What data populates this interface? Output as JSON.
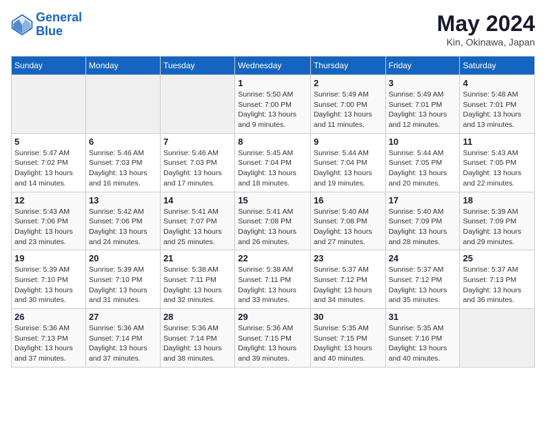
{
  "header": {
    "logo_line1": "General",
    "logo_line2": "Blue",
    "main_title": "May 2024",
    "subtitle": "Kin, Okinawa, Japan"
  },
  "weekdays": [
    "Sunday",
    "Monday",
    "Tuesday",
    "Wednesday",
    "Thursday",
    "Friday",
    "Saturday"
  ],
  "weeks": [
    [
      {
        "day": "",
        "info": ""
      },
      {
        "day": "",
        "info": ""
      },
      {
        "day": "",
        "info": ""
      },
      {
        "day": "1",
        "info": "Sunrise: 5:50 AM\nSunset: 7:00 PM\nDaylight: 13 hours and 9 minutes."
      },
      {
        "day": "2",
        "info": "Sunrise: 5:49 AM\nSunset: 7:00 PM\nDaylight: 13 hours and 11 minutes."
      },
      {
        "day": "3",
        "info": "Sunrise: 5:49 AM\nSunset: 7:01 PM\nDaylight: 13 hours and 12 minutes."
      },
      {
        "day": "4",
        "info": "Sunrise: 5:48 AM\nSunset: 7:01 PM\nDaylight: 13 hours and 13 minutes."
      }
    ],
    [
      {
        "day": "5",
        "info": "Sunrise: 5:47 AM\nSunset: 7:02 PM\nDaylight: 13 hours and 14 minutes."
      },
      {
        "day": "6",
        "info": "Sunrise: 5:46 AM\nSunset: 7:03 PM\nDaylight: 13 hours and 16 minutes."
      },
      {
        "day": "7",
        "info": "Sunrise: 5:46 AM\nSunset: 7:03 PM\nDaylight: 13 hours and 17 minutes."
      },
      {
        "day": "8",
        "info": "Sunrise: 5:45 AM\nSunset: 7:04 PM\nDaylight: 13 hours and 18 minutes."
      },
      {
        "day": "9",
        "info": "Sunrise: 5:44 AM\nSunset: 7:04 PM\nDaylight: 13 hours and 19 minutes."
      },
      {
        "day": "10",
        "info": "Sunrise: 5:44 AM\nSunset: 7:05 PM\nDaylight: 13 hours and 20 minutes."
      },
      {
        "day": "11",
        "info": "Sunrise: 5:43 AM\nSunset: 7:05 PM\nDaylight: 13 hours and 22 minutes."
      }
    ],
    [
      {
        "day": "12",
        "info": "Sunrise: 5:43 AM\nSunset: 7:06 PM\nDaylight: 13 hours and 23 minutes."
      },
      {
        "day": "13",
        "info": "Sunrise: 5:42 AM\nSunset: 7:06 PM\nDaylight: 13 hours and 24 minutes."
      },
      {
        "day": "14",
        "info": "Sunrise: 5:41 AM\nSunset: 7:07 PM\nDaylight: 13 hours and 25 minutes."
      },
      {
        "day": "15",
        "info": "Sunrise: 5:41 AM\nSunset: 7:08 PM\nDaylight: 13 hours and 26 minutes."
      },
      {
        "day": "16",
        "info": "Sunrise: 5:40 AM\nSunset: 7:08 PM\nDaylight: 13 hours and 27 minutes."
      },
      {
        "day": "17",
        "info": "Sunrise: 5:40 AM\nSunset: 7:09 PM\nDaylight: 13 hours and 28 minutes."
      },
      {
        "day": "18",
        "info": "Sunrise: 5:39 AM\nSunset: 7:09 PM\nDaylight: 13 hours and 29 minutes."
      }
    ],
    [
      {
        "day": "19",
        "info": "Sunrise: 5:39 AM\nSunset: 7:10 PM\nDaylight: 13 hours and 30 minutes."
      },
      {
        "day": "20",
        "info": "Sunrise: 5:39 AM\nSunset: 7:10 PM\nDaylight: 13 hours and 31 minutes."
      },
      {
        "day": "21",
        "info": "Sunrise: 5:38 AM\nSunset: 7:11 PM\nDaylight: 13 hours and 32 minutes."
      },
      {
        "day": "22",
        "info": "Sunrise: 5:38 AM\nSunset: 7:11 PM\nDaylight: 13 hours and 33 minutes."
      },
      {
        "day": "23",
        "info": "Sunrise: 5:37 AM\nSunset: 7:12 PM\nDaylight: 13 hours and 34 minutes."
      },
      {
        "day": "24",
        "info": "Sunrise: 5:37 AM\nSunset: 7:12 PM\nDaylight: 13 hours and 35 minutes."
      },
      {
        "day": "25",
        "info": "Sunrise: 5:37 AM\nSunset: 7:13 PM\nDaylight: 13 hours and 36 minutes."
      }
    ],
    [
      {
        "day": "26",
        "info": "Sunrise: 5:36 AM\nSunset: 7:13 PM\nDaylight: 13 hours and 37 minutes."
      },
      {
        "day": "27",
        "info": "Sunrise: 5:36 AM\nSunset: 7:14 PM\nDaylight: 13 hours and 37 minutes."
      },
      {
        "day": "28",
        "info": "Sunrise: 5:36 AM\nSunset: 7:14 PM\nDaylight: 13 hours and 38 minutes."
      },
      {
        "day": "29",
        "info": "Sunrise: 5:36 AM\nSunset: 7:15 PM\nDaylight: 13 hours and 39 minutes."
      },
      {
        "day": "30",
        "info": "Sunrise: 5:35 AM\nSunset: 7:15 PM\nDaylight: 13 hours and 40 minutes."
      },
      {
        "day": "31",
        "info": "Sunrise: 5:35 AM\nSunset: 7:16 PM\nDaylight: 13 hours and 40 minutes."
      },
      {
        "day": "",
        "info": ""
      }
    ]
  ]
}
